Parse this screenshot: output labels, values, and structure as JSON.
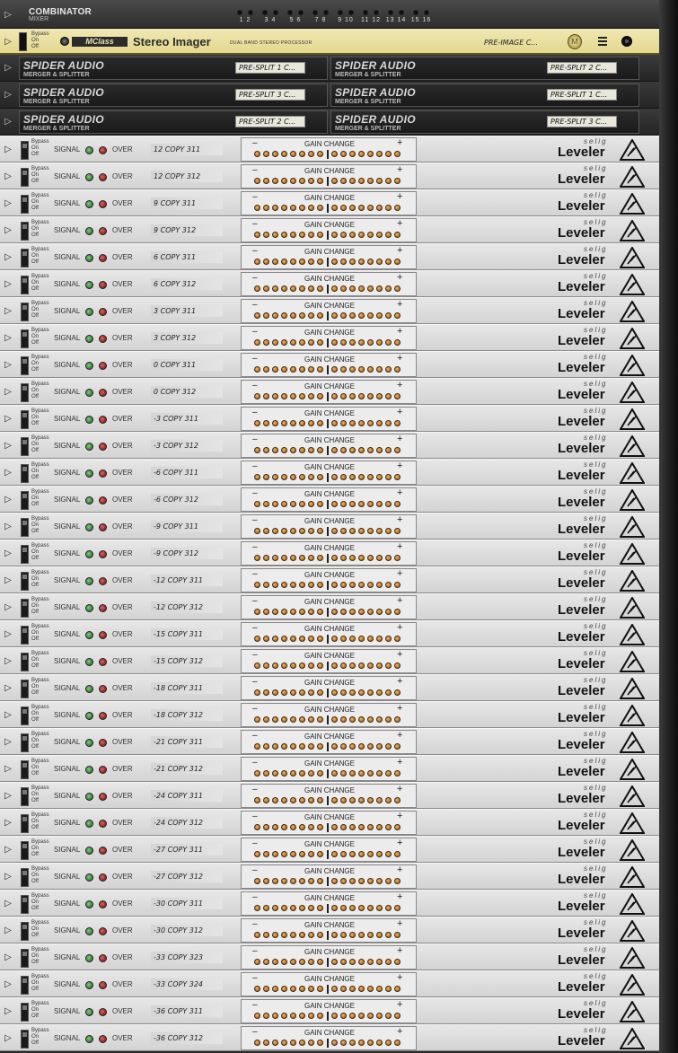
{
  "combinator": {
    "title": "COMBINATOR",
    "subtitle": "MIXER",
    "channels": [
      "1 2",
      "3 4",
      "5 6",
      "7 8",
      "9 10",
      "11 12",
      "13 14",
      "15 16"
    ]
  },
  "imager": {
    "bypass": [
      "Bypass",
      "On",
      "Off"
    ],
    "brand": "MClass",
    "title": "Stereo Imager",
    "subtitle": "DUAL BAND STEREO PROCESSOR",
    "preset": "PRE-IMAGE C..."
  },
  "spider_rows": [
    [
      {
        "name": "SPIDER AUDIO",
        "sub": "MERGER & SPLITTER",
        "preset": "PRE-SPLIT 1 C..."
      },
      {
        "name": "SPIDER AUDIO",
        "sub": "MERGER & SPLITTER",
        "preset": "PRE-SPLIT 2 C..."
      }
    ],
    [
      {
        "name": "SPIDER AUDIO",
        "sub": "MERGER & SPLITTER",
        "preset": "PRE-SPLIT 3 C..."
      },
      {
        "name": "SPIDER AUDIO",
        "sub": "MERGER & SPLITTER",
        "preset": "PRE-SPLIT 1 C..."
      }
    ],
    [
      {
        "name": "SPIDER AUDIO",
        "sub": "MERGER & SPLITTER",
        "preset": "PRE-SPLIT 2 C..."
      },
      {
        "name": "SPIDER AUDIO",
        "sub": "MERGER & SPLITTER",
        "preset": "PRE-SPLIT 3 C..."
      }
    ]
  ],
  "leveler_labels": {
    "bypass": "Bypass",
    "on": "On",
    "off": "Off",
    "signal": "SIGNAL",
    "over": "OVER",
    "gain": "GAIN CHANGE",
    "minus": "–",
    "plus": "+",
    "selig": "selig",
    "name": "Leveler"
  },
  "levelers": [
    "12 COPY 311",
    "12 COPY 312",
    "9 COPY 311",
    "9 COPY 312",
    "6 COPY 311",
    "6 COPY 312",
    "3 COPY 311",
    "3 COPY 312",
    "0 COPY 311",
    "0 COPY 312",
    "-3 COPY 311",
    "-3 COPY 312",
    "-6 COPY 311",
    "-6 COPY 312",
    "-9 COPY 311",
    "-9 COPY 312",
    "-12 COPY 311",
    "-12 COPY 312",
    "-15 COPY 311",
    "-15 COPY 312",
    "-18 COPY 311",
    "-18 COPY 312",
    "-21 COPY 311",
    "-21 COPY 312",
    "-24 COPY 311",
    "-24 COPY 312",
    "-27 COPY 311",
    "-27 COPY 312",
    "-30 COPY 311",
    "-30 COPY 312",
    "-33 COPY 323",
    "-33 COPY 324",
    "-36 COPY 311",
    "-36 COPY 312"
  ],
  "colors": {
    "imager_panel": "#e9df9e",
    "led_amber": "#e0a050",
    "signal_led": "#2f8a2f",
    "over_led": "#b02020"
  }
}
